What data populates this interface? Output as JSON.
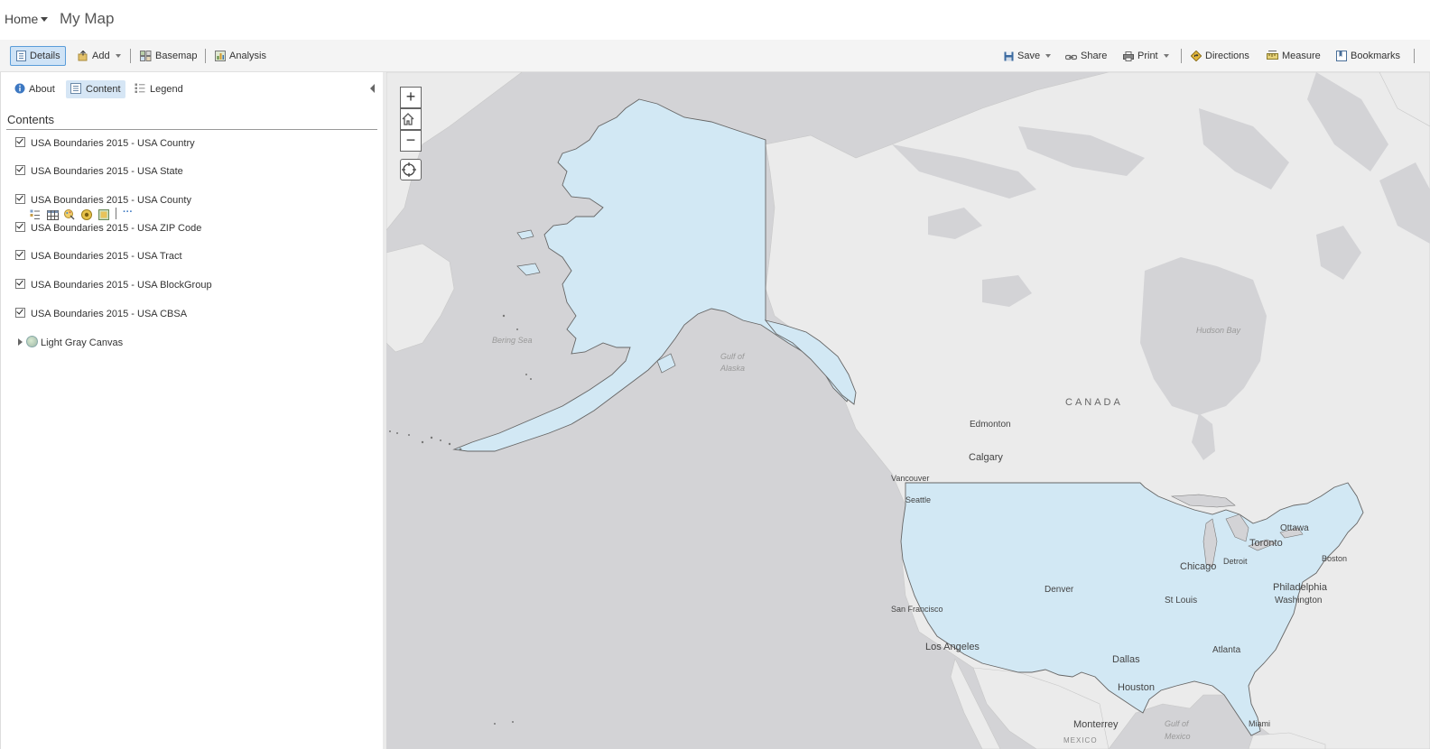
{
  "header": {
    "home_label": "Home",
    "map_title": "My Map"
  },
  "toolbar": {
    "details": "Details",
    "add": "Add",
    "basemap": "Basemap",
    "analysis": "Analysis",
    "save": "Save",
    "share": "Share",
    "print": "Print",
    "directions": "Directions",
    "measure": "Measure",
    "bookmarks": "Bookmarks"
  },
  "panel": {
    "tabs": {
      "about": "About",
      "content": "Content",
      "legend": "Legend"
    },
    "heading": "Contents",
    "layers": [
      {
        "name": "USA Boundaries 2015 - USA Country",
        "checked": true
      },
      {
        "name": "USA Boundaries 2015 - USA State",
        "checked": true
      },
      {
        "name": "USA Boundaries 2015 - USA County",
        "checked": true
      },
      {
        "name": "USA Boundaries 2015 - USA ZIP Code",
        "checked": true
      },
      {
        "name": "USA Boundaries 2015 - USA Tract",
        "checked": true
      },
      {
        "name": "USA Boundaries 2015 - USA BlockGroup",
        "checked": true
      },
      {
        "name": "USA Boundaries 2015 - USA CBSA",
        "checked": true
      }
    ],
    "layer_tools": [
      "show-legend-icon",
      "show-table-icon",
      "change-style-icon",
      "perform-analysis-icon",
      "show-item-details-icon",
      "more-options-icon"
    ],
    "more_glyph": "···",
    "basemap_layer": "Light Gray Canvas"
  },
  "map": {
    "zoom_in": "+",
    "zoom_out": "−",
    "country_label": "CANADA",
    "water_labels": {
      "bering": "Bering Sea",
      "alaska_gulf_1": "Gulf of",
      "alaska_gulf_2": "Alaska",
      "hudson": "Hudson Bay",
      "mexico_gulf_1": "Gulf of",
      "mexico_gulf_2": "Mexico"
    },
    "cities": {
      "edmonton": "Edmonton",
      "calgary": "Calgary",
      "vancouver": "Vancouver",
      "seattle": "Seattle",
      "ottawa": "Ottawa",
      "toronto": "Toronto",
      "boston": "Boston",
      "chicago": "Chicago",
      "detroit": "Detroit",
      "philadelphia": "Philadelphia",
      "washington": "Washington",
      "denver": "Denver",
      "stlouis": "St Louis",
      "sanfrancisco": "San Francisco",
      "losangeles": "Los Angeles",
      "atlanta": "Atlanta",
      "dallas": "Dallas",
      "houston": "Houston",
      "monterrey": "Monterrey",
      "miami": "Miami",
      "mexico": "MEXICO"
    },
    "colors": {
      "usa_fill": "#d2e8f4",
      "land": "#ebebeb",
      "water": "#d3d3d6"
    }
  }
}
